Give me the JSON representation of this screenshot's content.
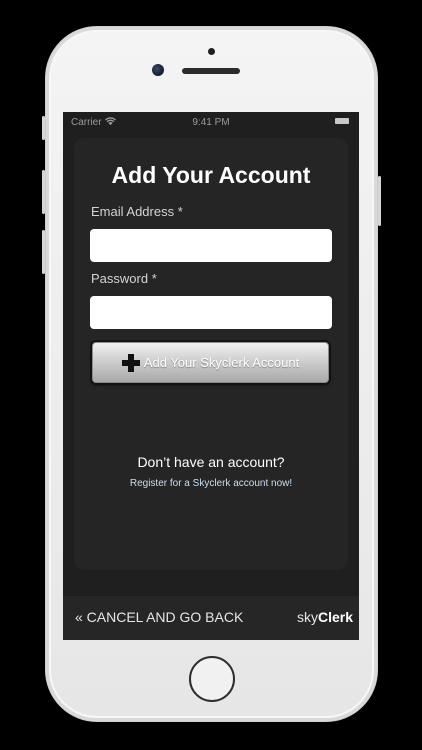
{
  "status_bar": {
    "carrier": "Carrier",
    "time": "9:41 PM"
  },
  "form": {
    "title": "Add Your Account",
    "email_label": "Email Address *",
    "email_value": "",
    "password_label": "Password *",
    "password_value": "",
    "submit_label": "Add Your Skyclerk Account",
    "submit_icon": "plus-icon"
  },
  "signup": {
    "prompt": "Don’t have an account?",
    "link_label": "Register for a Skyclerk account now!"
  },
  "footer": {
    "back_label": "« CANCEL AND GO BACK",
    "logo_light": "sky",
    "logo_bold": "Clerk"
  },
  "colors": {
    "screen_background": "#1f1f1f",
    "card_background": "#252525",
    "link": "#c9def2"
  }
}
